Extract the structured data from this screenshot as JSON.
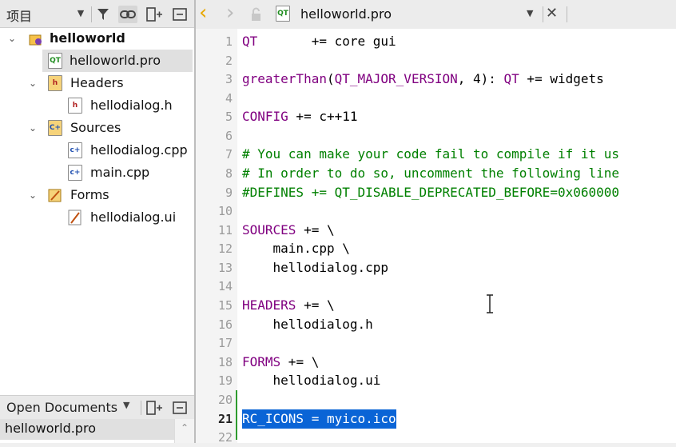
{
  "project_panel": {
    "title": "项目",
    "tree": [
      {
        "label": "helloworld",
        "bold": true
      },
      {
        "label": "helloworld.pro"
      },
      {
        "label": "Headers"
      },
      {
        "label": "hellodialog.h"
      },
      {
        "label": "Sources"
      },
      {
        "label": "hellodialog.cpp"
      },
      {
        "label": "main.cpp"
      },
      {
        "label": "Forms"
      },
      {
        "label": "hellodialog.ui"
      }
    ]
  },
  "open_documents": {
    "title": "Open Documents",
    "items": [
      "helloworld.pro"
    ]
  },
  "editor": {
    "file_name": "helloworld.pro",
    "line_numbers": [
      "1",
      "2",
      "3",
      "4",
      "5",
      "6",
      "7",
      "8",
      "9",
      "10",
      "11",
      "12",
      "13",
      "14",
      "15",
      "16",
      "17",
      "18",
      "19",
      "20",
      "21",
      "22"
    ],
    "current_line": "21",
    "lines": {
      "l1a": "QT",
      "l1b": "       += core gui",
      "l3a": "greaterThan",
      "l3b": "(",
      "l3c": "QT_MAJOR_VERSION",
      "l3d": ", 4): ",
      "l3e": "QT",
      "l3f": " += widgets",
      "l5a": "CONFIG",
      "l5b": " += c++11",
      "l7": "# You can make your code fail to compile if it us",
      "l8": "# In order to do so, uncomment the following line",
      "l9": "#DEFINES += QT_DISABLE_DEPRECATED_BEFORE=0x060000",
      "l11a": "SOURCES",
      "l11b": " += \\",
      "l12": "    main.cpp \\",
      "l13": "    hellodialog.cpp",
      "l15a": "HEADERS",
      "l15b": " += \\",
      "l16": "    hellodialog.h",
      "l18a": "FORMS",
      "l18b": " += \\",
      "l19": "    hellodialog.ui",
      "l21": "RC_ICONS = myico.ico"
    }
  },
  "icons": {
    "dropdown": "▼",
    "filter": "filter-icon",
    "link": "link-icon",
    "split": "split-icon",
    "close": "✕",
    "back": "‹",
    "forward": "›",
    "lock": "lock-icon",
    "collapse": "⌄",
    "scroll_up": "⌃"
  },
  "colors": {
    "keyword": "#800080",
    "comment": "#008000",
    "selection": "#0a64d6",
    "mark": "#2e9c2e"
  }
}
